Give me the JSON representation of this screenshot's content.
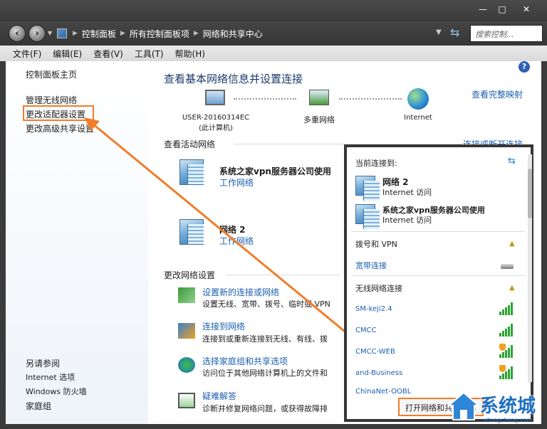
{
  "window": {
    "minimize": "—",
    "maximize": "□",
    "close": "✕"
  },
  "breadcrumbs": [
    "控制面板",
    "所有控制面板项",
    "网络和共享中心"
  ],
  "search": {
    "placeholder": "搜索控制..."
  },
  "menu": [
    "文件(F)",
    "编辑(E)",
    "查看(V)",
    "工具(T)",
    "帮助(H)"
  ],
  "left": {
    "home": "控制面板主页",
    "links": [
      "管理无线网络",
      "更改适配器设置",
      "更改高级共享设置"
    ],
    "see_also_title": "另请参阅",
    "see_also": [
      "Internet 选项",
      "Windows 防火墙",
      "家庭组"
    ]
  },
  "main": {
    "title": "查看基本网络信息并设置连接",
    "full_map": "查看完整映射",
    "nodes": [
      {
        "line1": "USER-20160314EC",
        "line2": "(此计算机)"
      },
      {
        "line1": "多重网络",
        "line2": ""
      },
      {
        "line1": "Internet",
        "line2": ""
      }
    ],
    "active_title": "查看活动网络",
    "connect_disconnect": "连接或断开连接",
    "networks": [
      {
        "name": "系统之家vpn服务器公司使用",
        "type": "工作网络"
      },
      {
        "name": "网络  2",
        "type": "工作网络"
      }
    ],
    "change_title": "更改网络设置",
    "tasks": [
      {
        "title": "设置新的连接或网络",
        "desc": "设置无线、宽带、拨号、临时或 VPN"
      },
      {
        "title": "连接到网络",
        "desc": "连接到或重新连接到无线、有线、拨"
      },
      {
        "title": "选择家庭组和共享选项",
        "desc": "访问位于其他网络计算机上的文件和"
      },
      {
        "title": "疑难解答",
        "desc": "诊断并修复网络问题，或获得故障排"
      }
    ]
  },
  "popup": {
    "current": "当前连接到:",
    "connections": [
      {
        "name": "网络  2",
        "access": "Internet 访问"
      },
      {
        "name": "系统之家vpn服务器公司使用",
        "access": "Internet 访问"
      }
    ],
    "dial_title": "拨号和 VPN",
    "broadband": "宽带连接",
    "wireless_title": "无线网络连接",
    "wifi": [
      {
        "ssid": "SM-keji2.4",
        "secured": false
      },
      {
        "ssid": "CMCC",
        "secured": false
      },
      {
        "ssid": "CMCC-WEB",
        "secured": true
      },
      {
        "ssid": "and-Business",
        "secured": true
      },
      {
        "ssid": "ChinaNet-QQBL",
        "secured": false
      }
    ],
    "open_button": "打开网络和共享中心"
  },
  "watermark": {
    "brand": "系统城",
    "url": "xitongcheng.com"
  },
  "colors": {
    "accent": "#1b5fb0",
    "highlight": "#f07d2a"
  }
}
